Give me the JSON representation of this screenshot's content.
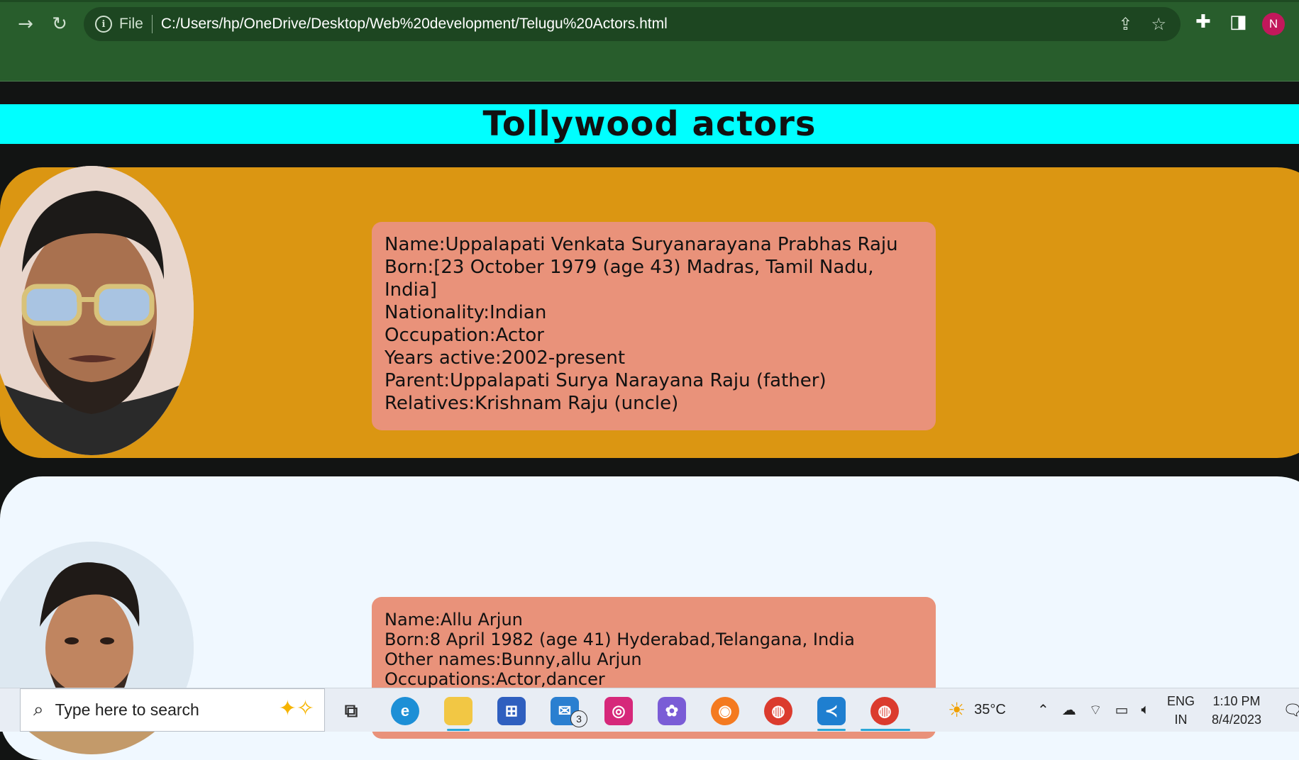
{
  "browser": {
    "scheme_label": "File",
    "url": "C:/Users/hp/OneDrive/Desktop/Web%20development/Telugu%20Actors.html",
    "profile_initial": "N",
    "theme_color": "#285d2c"
  },
  "page": {
    "title": "Tollywood actors",
    "title_bg": "#00ffff",
    "actors": [
      {
        "card_color": "#db9612",
        "box_color": "#e9927a",
        "lines": [
          "Name:Uppalapati Venkata Suryanarayana Prabhas Raju",
          "Born:[23 October 1979 (age 43) Madras, Tamil Nadu, India]",
          "Nationality:Indian",
          "Occupation:Actor",
          "Years active:2002-present",
          "Parent:Uppalapati Surya Narayana Raju (father)",
          "Relatives:Krishnam Raju (uncle)"
        ]
      },
      {
        "card_color": "#f0f8ff",
        "box_color": "#e9927a",
        "lines": [
          "Name:Allu Arjun",
          "Born:8 April 1982 (age 41) Hyderabad,Telangana, India",
          "Other names:Bunny,allu Arjun",
          "Occupations:Actor,dancer"
        ]
      }
    ]
  },
  "taskbar": {
    "search_placeholder": "Type here to search",
    "mail_badge": "3",
    "weather": "35°C",
    "lang_top": "ENG",
    "lang_bottom": "IN",
    "time": "1:10 PM",
    "date": "8/4/2023"
  }
}
